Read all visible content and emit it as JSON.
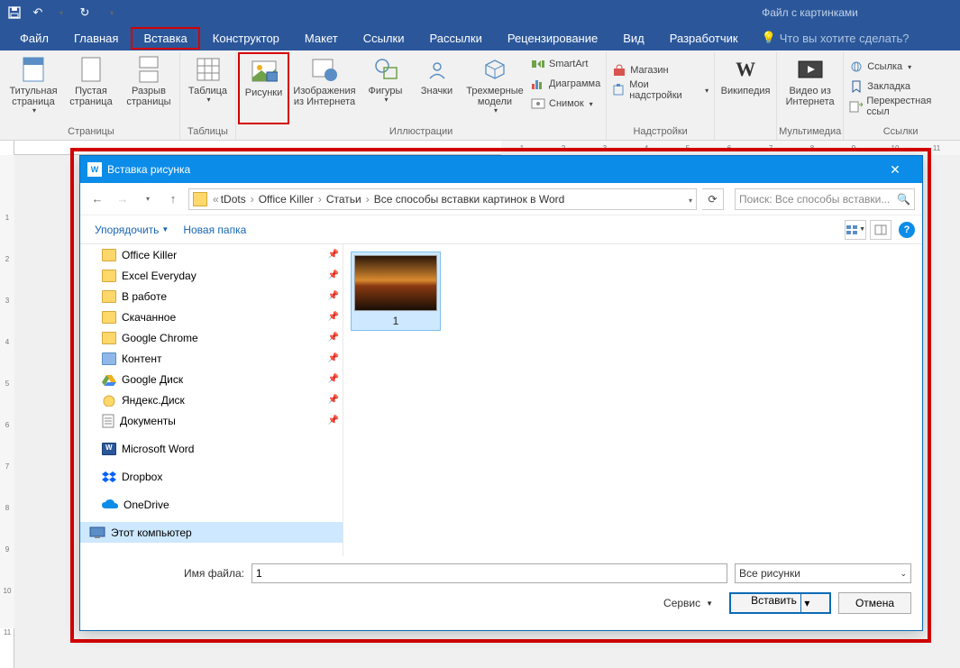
{
  "titlebar": {
    "doc_title": "Файл с картинками"
  },
  "menu": {
    "tabs": [
      "Файл",
      "Главная",
      "Вставка",
      "Конструктор",
      "Макет",
      "Ссылки",
      "Рассылки",
      "Рецензирование",
      "Вид",
      "Разработчик"
    ],
    "selected_index": 2,
    "tellme": "Что вы хотите сделать?"
  },
  "ribbon": {
    "groups": {
      "pages": {
        "label": "Страницы",
        "btns": [
          "Титульная страница",
          "Пустая страница",
          "Разрыв страницы"
        ]
      },
      "tables": {
        "label": "Таблицы",
        "btn": "Таблица"
      },
      "illustrations": {
        "label": "Иллюстрации",
        "btns": [
          "Рисунки",
          "Изображения из Интернета",
          "Фигуры",
          "Значки",
          "Трехмерные модели"
        ],
        "stack": [
          "SmartArt",
          "Диаграмма",
          "Снимок"
        ]
      },
      "addins": {
        "label": "Надстройки",
        "stack": [
          "Магазин",
          "Мои надстройки"
        ]
      },
      "wiki": {
        "btn": "Википедия"
      },
      "media": {
        "label": "Мультимедиа",
        "btn": "Видео из Интернета"
      },
      "links": {
        "label": "Ссылки",
        "stack": [
          "Ссылка",
          "Закладка",
          "Перекрестная ссыл"
        ]
      }
    }
  },
  "dialog": {
    "title": "Вставка рисунка",
    "breadcrumb": [
      "tDots",
      "Office Killer",
      "Статьи",
      "Все способы вставки картинок в Word"
    ],
    "search_placeholder": "Поиск: Все способы вставки...",
    "toolbar": {
      "organize": "Упорядочить",
      "newfolder": "Новая папка"
    },
    "tree": [
      {
        "name": "Office Killer",
        "icon": "folder",
        "pin": true
      },
      {
        "name": "Excel Everyday",
        "icon": "folder",
        "pin": true
      },
      {
        "name": "В работе",
        "icon": "folder",
        "pin": true
      },
      {
        "name": "Скачанное",
        "icon": "folder",
        "pin": true
      },
      {
        "name": "Google Chrome",
        "icon": "folder",
        "pin": true
      },
      {
        "name": "Контент",
        "icon": "folder-blue",
        "pin": true
      },
      {
        "name": "Google Диск",
        "icon": "gdrive",
        "pin": true
      },
      {
        "name": "Яндекс.Диск",
        "icon": "ydisk",
        "pin": true
      },
      {
        "name": "Документы",
        "icon": "doc",
        "pin": true
      },
      {
        "name": "Microsoft Word",
        "icon": "word",
        "pin": false,
        "gap": true
      },
      {
        "name": "Dropbox",
        "icon": "dropbox",
        "pin": false,
        "gap": true
      },
      {
        "name": "OneDrive",
        "icon": "onedrive",
        "pin": false,
        "gap": true
      },
      {
        "name": "Этот компьютер",
        "icon": "pc",
        "pin": false,
        "selected": true,
        "gap": true,
        "thispc": true
      }
    ],
    "thumb_caption": "1",
    "filename_label": "Имя файла:",
    "filename_value": "1",
    "filter": "Все рисунки",
    "service": "Сервис",
    "insert": "Вставить",
    "cancel": "Отмена"
  }
}
